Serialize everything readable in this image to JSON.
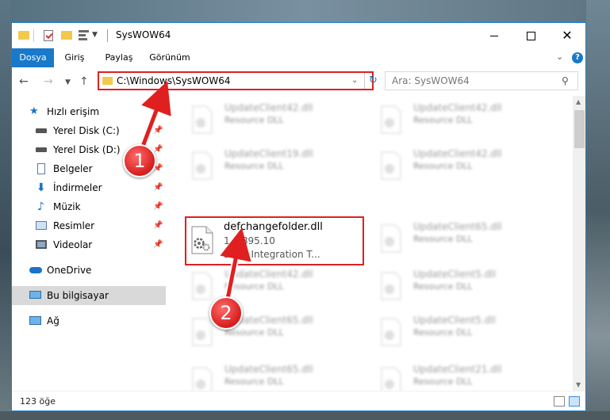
{
  "window": {
    "title": "SysWOW64",
    "controls": {
      "minimize": "—",
      "maximize": "",
      "close": "✕"
    }
  },
  "ribbon": {
    "tabs": [
      "Dosya",
      "Giriş",
      "Paylaş",
      "Görünüm"
    ],
    "help_label": "?"
  },
  "navigation": {
    "address": "C:\\Windows\\SysWOW64",
    "search_placeholder": "Ara: SysWOW64"
  },
  "sidebar": {
    "items": [
      {
        "label": "Hızlı erişim",
        "icon": "star-icon"
      },
      {
        "label": "Yerel Disk (C:)",
        "icon": "drive-icon"
      },
      {
        "label": "Yerel Disk (D:)",
        "icon": "drive-icon"
      },
      {
        "label": "Belgeler",
        "icon": "documents-icon"
      },
      {
        "label": "İndirmeler",
        "icon": "download-icon"
      },
      {
        "label": "Müzik",
        "icon": "music-icon"
      },
      {
        "label": "Resimler",
        "icon": "pictures-icon"
      },
      {
        "label": "Videolar",
        "icon": "videos-icon"
      },
      {
        "label": "OneDrive",
        "icon": "cloud-icon"
      },
      {
        "label": "Bu bilgisayar",
        "icon": "computer-icon"
      },
      {
        "label": "Ağ",
        "icon": "network-icon"
      }
    ],
    "pin_glyph": "📌"
  },
  "files": {
    "highlighted": {
      "name": "defchangefolder.dll",
      "version": "1.0.895.10",
      "description": "Suite Integration T..."
    },
    "left_column": [
      {
        "name": "UpdateClient42.dll",
        "description": "Resource DLL"
      },
      {
        "name": "UpdateClient19.dll",
        "description": "Resource DLL"
      },
      {
        "name": "UpdateClient42.dll",
        "description": "Resource DLL"
      },
      {
        "name": "UpdateClient65.dll",
        "description": "Resource DLL"
      },
      {
        "name": "UpdateClient65.dll",
        "description": "Resource DLL"
      }
    ],
    "right_column": [
      {
        "name": "UpdateClient42.dll",
        "description": "Resource DLL"
      },
      {
        "name": "UpdateClient42.dll",
        "description": "Resource DLL"
      },
      {
        "name": "UpdateClient65.dll",
        "description": "Resource DLL"
      },
      {
        "name": "UpdateClient5.dll",
        "description": "Resource DLL"
      },
      {
        "name": "UpdateClient5.dll",
        "description": "Resource DLL"
      },
      {
        "name": "UpdateClient21.dll",
        "description": "Resource DLL"
      }
    ]
  },
  "status": {
    "item_count": "123 öğe"
  },
  "annotations": {
    "step1": "1",
    "step2": "2",
    "color": "#e02020"
  }
}
